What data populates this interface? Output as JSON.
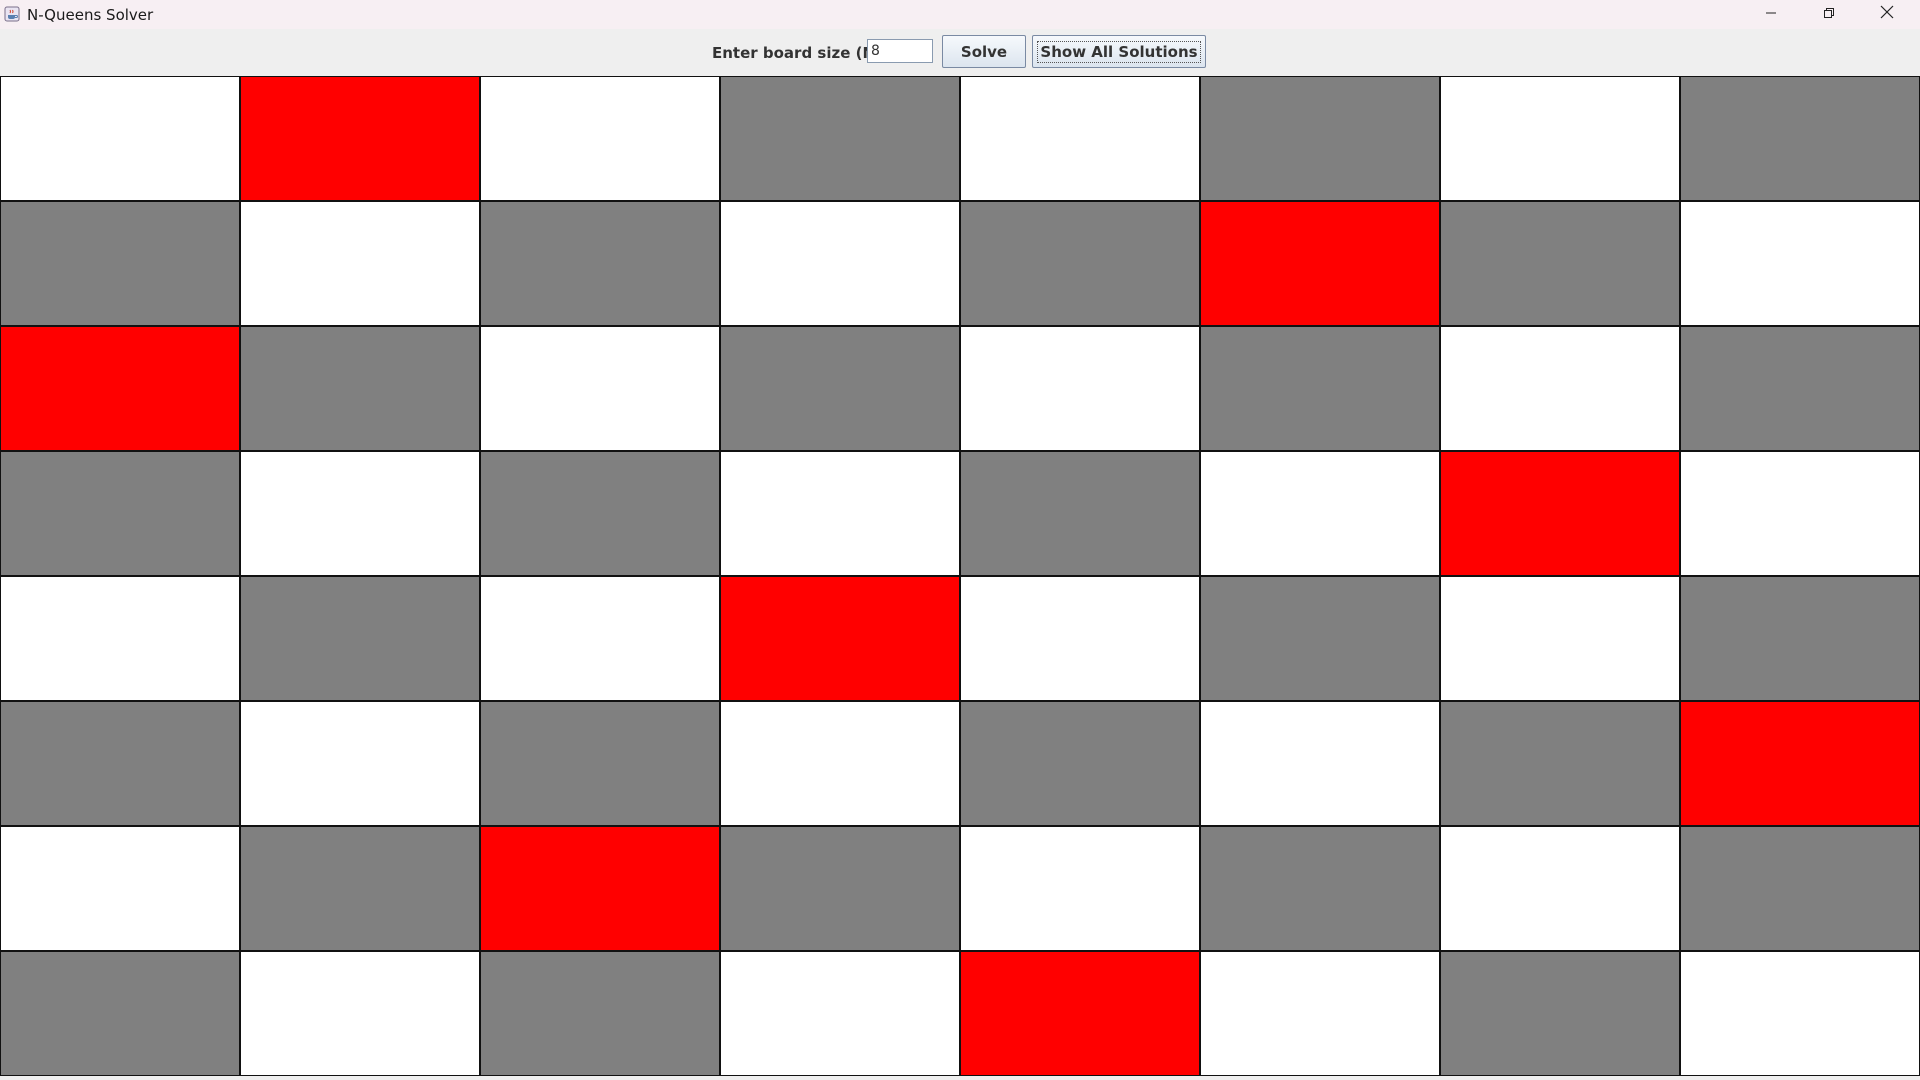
{
  "window": {
    "title": "N-Queens Solver",
    "icons": {
      "app": "java-cup-icon",
      "minimize": "minimize-icon",
      "maximize": "restore-icon",
      "close": "close-icon"
    }
  },
  "toolbar": {
    "label": "Enter board size (N):",
    "board_size_value": "8",
    "solve_label": "Solve",
    "show_all_label": "Show All Solutions"
  },
  "board": {
    "size": 8,
    "queens_by_row": [
      1,
      5,
      0,
      6,
      3,
      7,
      2,
      4
    ],
    "colors": {
      "light": "#ffffff",
      "dark": "#808080",
      "queen": "#ff0000",
      "grid": "#111111"
    }
  }
}
